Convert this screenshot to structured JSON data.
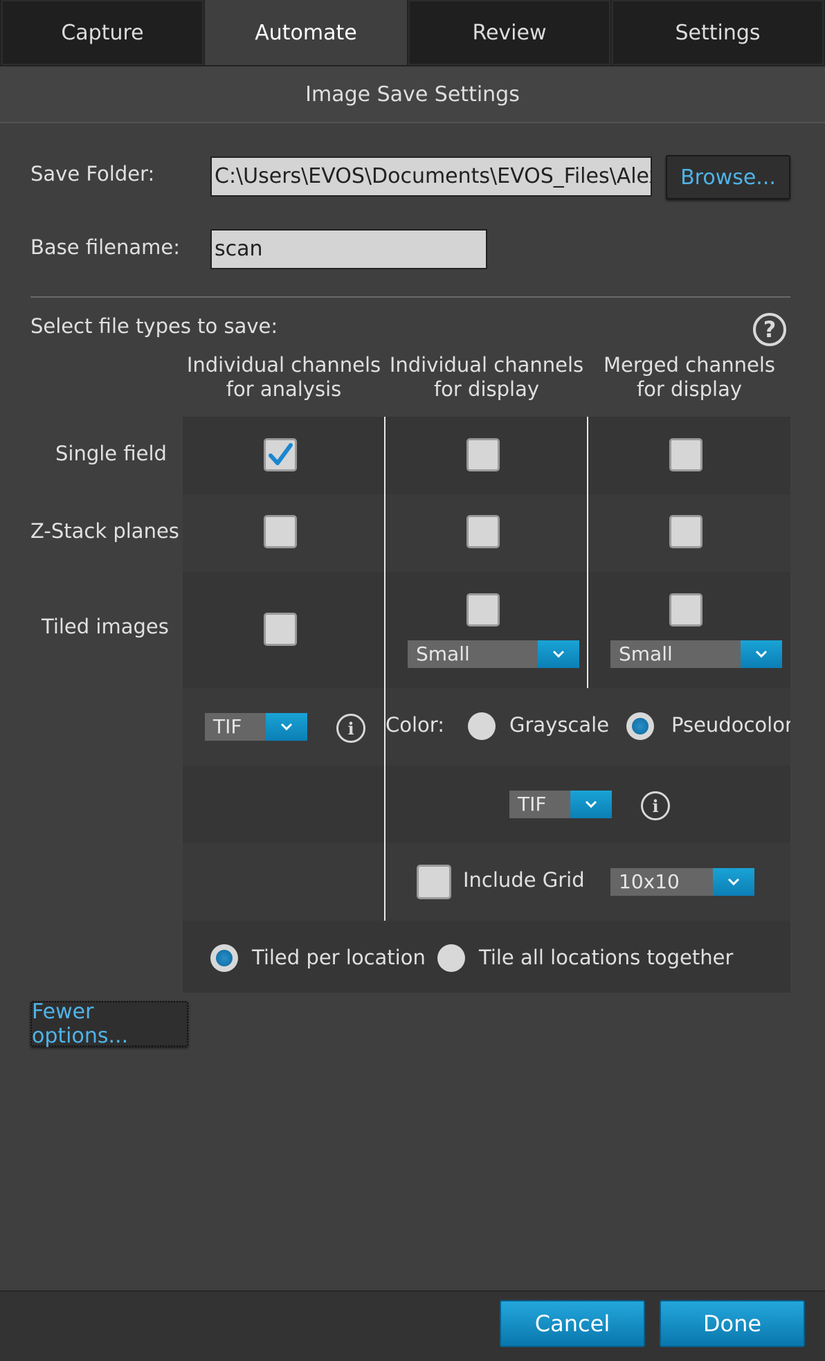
{
  "tabs": [
    "Capture",
    "Automate",
    "Review",
    "Settings"
  ],
  "active_tab": "Automate",
  "header": {
    "title": "Image Save Settings"
  },
  "save_folder": {
    "label": "Save Folder:",
    "value": "C:\\Users\\EVOS\\Documents\\EVOS_Files\\Alex T",
    "browse_label": "Browse..."
  },
  "base_filename": {
    "label": "Base filename:",
    "value": "scan"
  },
  "file_types": {
    "label": "Select file types to save:",
    "help_icon": "question-circle-icon",
    "col_headers": [
      [
        "Individual channels",
        "for analysis"
      ],
      [
        "Individual channels",
        "for display"
      ],
      [
        "Merged channels",
        "for display"
      ]
    ],
    "rows": [
      {
        "label": "Single field",
        "checked": [
          true,
          false,
          false
        ]
      },
      {
        "label": "Z-Stack planes",
        "checked": [
          false,
          false,
          false
        ]
      },
      {
        "label": "Tiled images",
        "checked": [
          false,
          false,
          false
        ]
      }
    ],
    "tile_size_display": "Small",
    "tile_size_merged": "Small",
    "analysis_format": "TIF",
    "color": {
      "label": "Color:",
      "options": [
        "Grayscale",
        "Pseudocolor"
      ],
      "selected": "Pseudocolor"
    },
    "display_format": "TIF",
    "include_grid": {
      "label": "Include Grid",
      "checked": false,
      "size": "10x10"
    },
    "tiling": {
      "options": [
        "Tiled per location",
        "Tile all locations together"
      ],
      "selected": "Tiled per location"
    }
  },
  "fewer_options_label": "Fewer options...",
  "footer": {
    "cancel_label": "Cancel",
    "done_label": "Done"
  },
  "colors": {
    "accent": "#1a9fd8",
    "link": "#4fb3e8",
    "background": "#3f3f3f"
  }
}
